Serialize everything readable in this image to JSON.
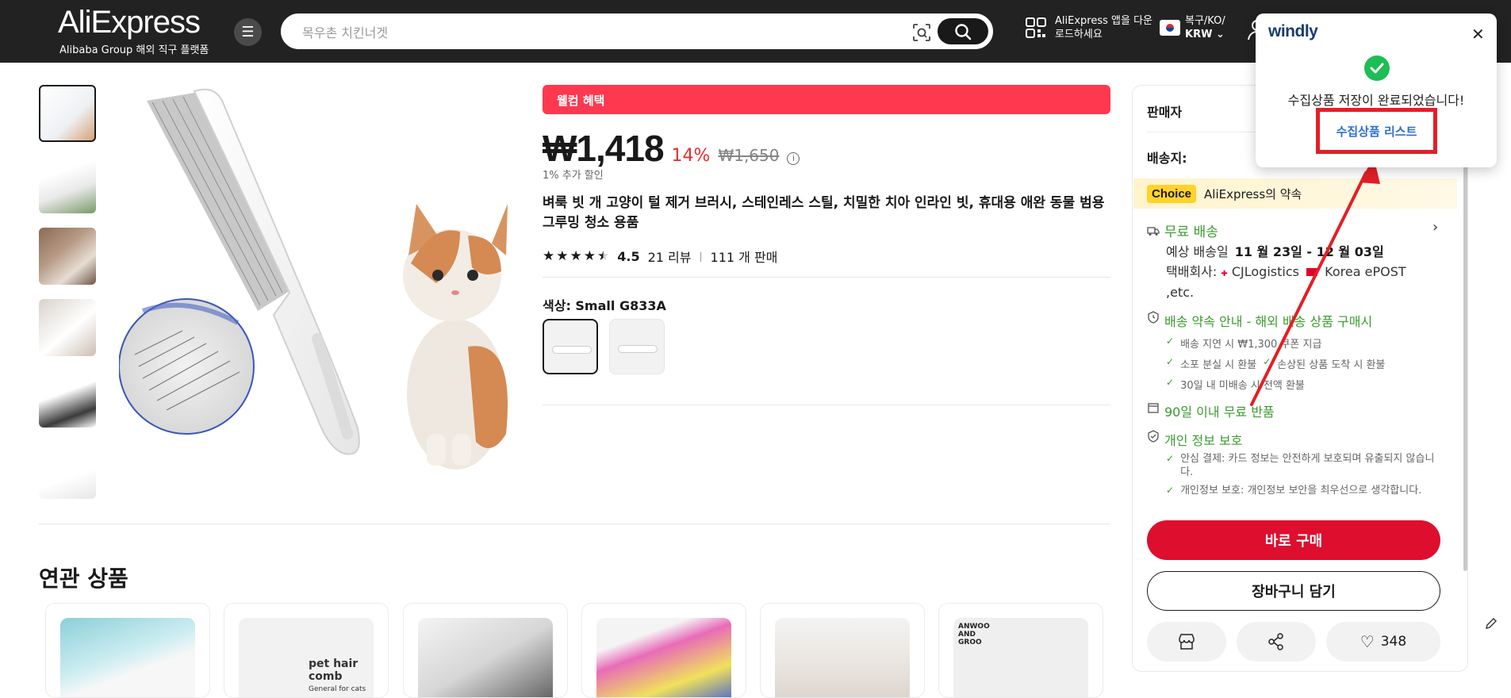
{
  "header": {
    "logo": "AliExpress",
    "logo_sub": "Alibaba Group 해외 직구 플랫폼",
    "search_placeholder": "목우촌 치킨너겟",
    "app_download": "AliExpress 앱을 다운로드하세요",
    "locale_line1": "복구/KO/",
    "locale_line2": "KRW"
  },
  "product": {
    "welcome_banner": "웰컴 혜택",
    "price": "₩1,418",
    "discount": "14%",
    "original_price": "₩1,650",
    "extra_discount": "1% 추가 할인",
    "title": "벼룩 빗 개 고양이 털 제거 브러시, 스테인레스 스틸, 치밀한 치아 인라인 빗, 휴대용 애완 동물 범용 그루밍 청소 용품",
    "rating": "4.5",
    "reviews": "21 리뷰",
    "sold": "111 개 판매",
    "color_label": "색상: Small G833A",
    "star_rating_value": 4.5
  },
  "related": {
    "title": "연관 상품",
    "card2_text": "pet hair comb",
    "card2_sub": "General  for cats and dogs",
    "card6_text": "ANWOO AND GROO"
  },
  "side": {
    "seller_label": "판매자",
    "ship_to_label": "배송지:",
    "choice_badge": "Choice",
    "choice_text": "AliExpress의 약속",
    "free_shipping": "무료 배송",
    "eta_label": "예상 배송일",
    "eta_value": "11 월 23일 - 12 월 03일",
    "carrier_label": "택배회사:",
    "carrier_value": "CJLogistics",
    "carrier_rest": "Korea ePOST ,etc.",
    "promise_title": "배송 약속 안내 - 해외 배송 상품 구매시",
    "promise_1": "배송 지연 시 ₩1,300 쿠폰 지급",
    "promise_2": "소포 분실 시 환불",
    "promise_2b": "손상된 상품 도착 시 환불",
    "promise_3": "30일 내 미배송 시 전액 환불",
    "returns": "90일 이내 무료 반품",
    "privacy_title": "개인 정보 보호",
    "privacy_1": "안심 결제: 카드 정보는 안전하게 보호되며 유출되지 않습니다.",
    "privacy_2": "개인정보 보호: 개인정보 보안을 최우선으로 생각합니다.",
    "buy_now": "바로 구매",
    "add_cart": "장바구니 담기",
    "wishlist_count": "348"
  },
  "popup": {
    "brand": "windly",
    "message": "수집상품 저장이 완료되었습니다!",
    "link": "수집상품 리스트"
  },
  "colors": {
    "header_bg": "#222222",
    "welcome_red": "#fd384f",
    "buy_red": "#dd0e2e",
    "green": "#3b9b2f",
    "choice_yellow": "#ffd32a",
    "annotation_red": "#e41e26"
  }
}
